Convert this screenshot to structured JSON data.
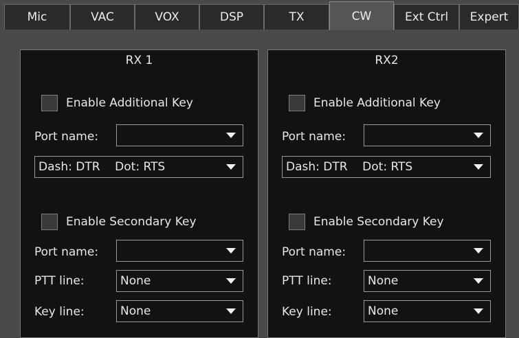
{
  "tabs": [
    {
      "label": "Mic"
    },
    {
      "label": "VAC"
    },
    {
      "label": "VOX"
    },
    {
      "label": "DSP"
    },
    {
      "label": "TX"
    },
    {
      "label": "CW",
      "active": true
    },
    {
      "label": "Ext Ctrl"
    },
    {
      "label": "Expert"
    }
  ],
  "panels": [
    {
      "title": "RX 1",
      "enable_additional_key": "Enable Additional Key",
      "port_name_label_1": "Port name:",
      "port_name_value_1": "",
      "dash_dot_value": "Dash: DTR    Dot: RTS",
      "enable_secondary_key": "Enable Secondary Key",
      "port_name_label_2": "Port name:",
      "port_name_value_2": "",
      "ptt_line_label": "PTT line:",
      "ptt_line_value": "None",
      "key_line_label": "Key line:",
      "key_line_value": "None"
    },
    {
      "title": "RX2",
      "enable_additional_key": "Enable Additional Key",
      "port_name_label_1": "Port name:",
      "port_name_value_1": "",
      "dash_dot_value": "Dash: DTR    Dot: RTS",
      "enable_secondary_key": "Enable Secondary Key",
      "port_name_label_2": "Port name:",
      "port_name_value_2": "",
      "ptt_line_label": "PTT line:",
      "ptt_line_value": "None",
      "key_line_label": "Key line:",
      "key_line_value": "None"
    }
  ]
}
